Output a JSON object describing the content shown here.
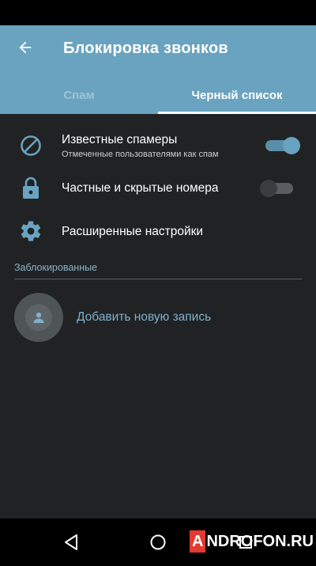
{
  "appbar": {
    "title": "Блокировка звонков",
    "back_icon": "arrow-left-icon"
  },
  "tabs": [
    {
      "label": "Спам",
      "active": false
    },
    {
      "label": "Черный список",
      "active": true
    }
  ],
  "settings": [
    {
      "icon": "block-icon",
      "title": "Известные спамеры",
      "subtitle": "Отмеченные пользователями как спам",
      "toggle": true
    },
    {
      "icon": "lock-icon",
      "title": "Частные и скрытые номера",
      "toggle": false
    },
    {
      "icon": "gear-icon",
      "title": "Расширенные настройки"
    }
  ],
  "blocked": {
    "section_label": "Заблокированные",
    "add_label": "Добавить новую запись",
    "add_icon": "contact-avatar-icon"
  },
  "navbar": {
    "back_icon": "triangle-back-icon",
    "home_icon": "circle-home-icon",
    "recents_icon": "square-recents-icon"
  },
  "watermark": {
    "first": "A",
    "rest": "NDROFON.RU"
  },
  "colors": {
    "appbar": "#6aa3bf",
    "background": "#202224",
    "accent_text": "#7eb1cb"
  }
}
